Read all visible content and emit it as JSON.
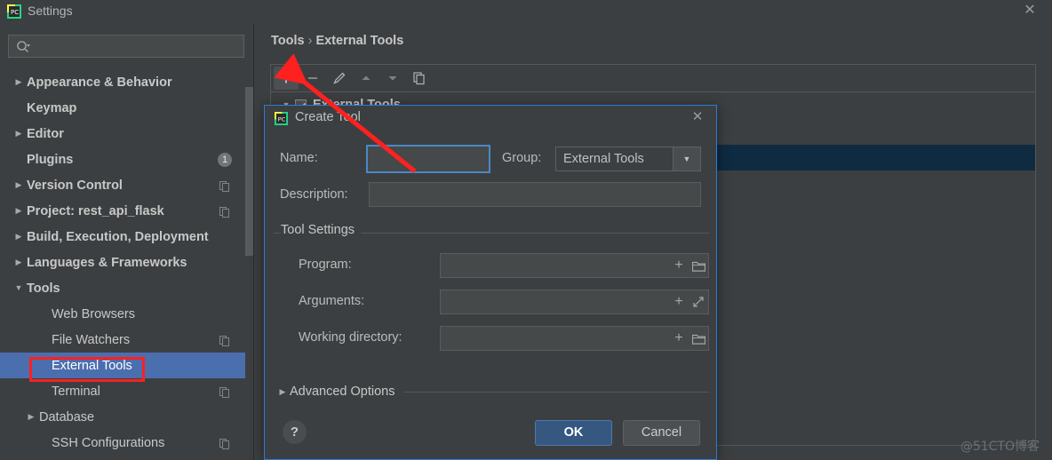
{
  "window": {
    "title": "Settings",
    "app_icon": "pycharm-icon",
    "close_label": "✕"
  },
  "search": {
    "value": "",
    "placeholder": "",
    "icon": "search-icon"
  },
  "sidebar": {
    "items": [
      {
        "label": "Appearance & Behavior",
        "level": "top",
        "arrow": "▶",
        "expandable": true,
        "selected": false,
        "badge": null,
        "copy": false
      },
      {
        "label": "Keymap",
        "level": "top",
        "arrow": "",
        "expandable": false,
        "selected": false,
        "badge": null,
        "copy": false
      },
      {
        "label": "Editor",
        "level": "top",
        "arrow": "▶",
        "expandable": true,
        "selected": false,
        "badge": null,
        "copy": false
      },
      {
        "label": "Plugins",
        "level": "top",
        "arrow": "",
        "expandable": false,
        "selected": false,
        "badge": "1",
        "copy": false
      },
      {
        "label": "Version Control",
        "level": "top",
        "arrow": "▶",
        "expandable": true,
        "selected": false,
        "badge": null,
        "copy": true
      },
      {
        "label": "Project: rest_api_flask",
        "level": "top",
        "arrow": "▶",
        "expandable": true,
        "selected": false,
        "badge": null,
        "copy": true
      },
      {
        "label": "Build, Execution, Deployment",
        "level": "top",
        "arrow": "▶",
        "expandable": true,
        "selected": false,
        "badge": null,
        "copy": false
      },
      {
        "label": "Languages & Frameworks",
        "level": "top",
        "arrow": "▶",
        "expandable": true,
        "selected": false,
        "badge": null,
        "copy": false
      },
      {
        "label": "Tools",
        "level": "top",
        "arrow": "▼",
        "expandable": true,
        "selected": false,
        "badge": null,
        "copy": false
      },
      {
        "label": "Web Browsers",
        "level": "child",
        "arrow": "",
        "expandable": false,
        "selected": false,
        "badge": null,
        "copy": false
      },
      {
        "label": "File Watchers",
        "level": "child",
        "arrow": "",
        "expandable": false,
        "selected": false,
        "badge": null,
        "copy": true
      },
      {
        "label": "External Tools",
        "level": "child",
        "arrow": "",
        "expandable": false,
        "selected": true,
        "badge": null,
        "copy": false
      },
      {
        "label": "Terminal",
        "level": "child",
        "arrow": "",
        "expandable": false,
        "selected": false,
        "badge": null,
        "copy": true
      },
      {
        "label": "Database",
        "level": "child2",
        "arrow": "▶",
        "expandable": true,
        "selected": false,
        "badge": null,
        "copy": false
      },
      {
        "label": "SSH Configurations",
        "level": "child",
        "arrow": "",
        "expandable": false,
        "selected": false,
        "badge": null,
        "copy": true
      }
    ]
  },
  "main": {
    "breadcrumb": {
      "parent": "Tools",
      "separator": "›",
      "current": "External Tools"
    },
    "toolbar": [
      {
        "name": "add-button",
        "icon": "plus-icon",
        "active": true
      },
      {
        "name": "remove-button",
        "icon": "minus-icon",
        "active": false
      },
      {
        "name": "edit-button",
        "icon": "pencil-icon",
        "active": false
      },
      {
        "name": "move-up-button",
        "icon": "arrow-up-icon",
        "active": false
      },
      {
        "name": "move-down-button",
        "icon": "arrow-down-icon",
        "active": false
      },
      {
        "name": "copy-button",
        "icon": "copy-icon",
        "active": false
      }
    ],
    "tree": {
      "root_label": "External Tools",
      "root_arrow": "▼",
      "root_checked": true
    }
  },
  "dialog": {
    "title": "Create Tool",
    "icon": "pycharm-icon",
    "close_label": "✕",
    "name_label": "Name:",
    "name_value": "",
    "group_label": "Group:",
    "group_value": "External Tools",
    "group_arrow": "▼",
    "description_label": "Description:",
    "description_value": "",
    "tool_settings_legend": "Tool Settings",
    "fields": [
      {
        "label": "Program:",
        "value": "",
        "plus": "+",
        "trailing_icon": "folder-icon"
      },
      {
        "label": "Arguments:",
        "value": "",
        "plus": "+",
        "trailing_icon": "expand-icon"
      },
      {
        "label": "Working directory:",
        "value": "",
        "plus": "+",
        "trailing_icon": "folder-icon"
      }
    ],
    "advanced_options_label": "Advanced Options",
    "advanced_arrow": "▶",
    "help_label": "?",
    "ok_label": "OK",
    "cancel_label": "Cancel"
  },
  "annotations": {
    "arrow_color": "#ff2020",
    "highlight_box_color": "#ff2020",
    "watermark": "@51CTO博客"
  }
}
